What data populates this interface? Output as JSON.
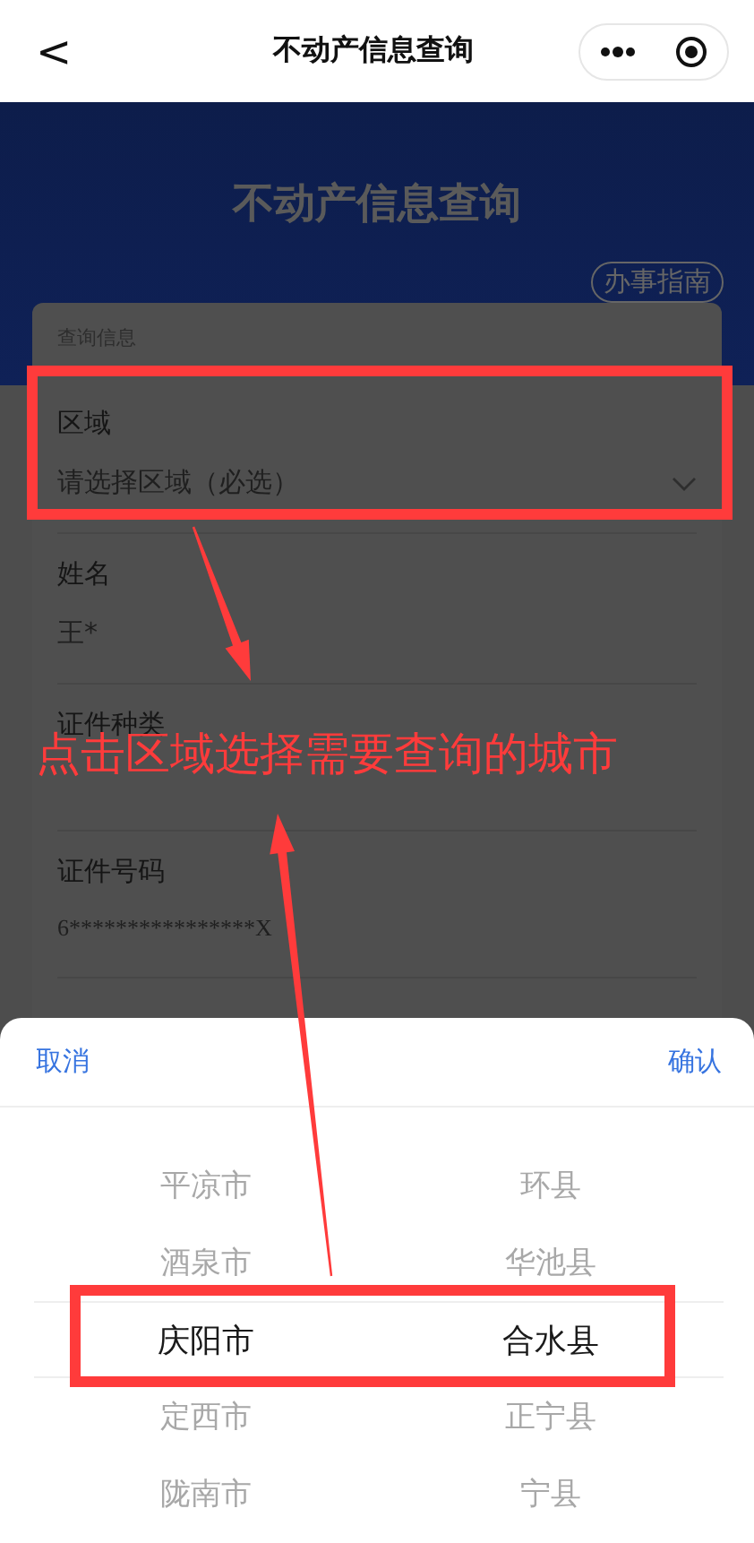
{
  "nav": {
    "back": "<",
    "title": "不动产信息查询"
  },
  "header": {
    "title": "不动产信息查询",
    "guide_button": "办事指南"
  },
  "form": {
    "section_title": "查询信息",
    "fields": [
      {
        "kind": "select",
        "label": "区域",
        "placeholder": "请选择区域（必选）"
      },
      {
        "kind": "text",
        "label": "姓名",
        "value": "王*"
      },
      {
        "kind": "text",
        "label": "证件种类"
      },
      {
        "kind": "text",
        "label": "证件号码",
        "value": "6****************X"
      }
    ]
  },
  "picker": {
    "cancel": "取消",
    "confirm": "确认",
    "columns": [
      {
        "items": [
          {
            "label": "平凉市",
            "selected": false
          },
          {
            "label": "酒泉市",
            "selected": false
          },
          {
            "label": "庆阳市",
            "selected": true
          },
          {
            "label": "定西市",
            "selected": false
          },
          {
            "label": "陇南市",
            "selected": false
          }
        ]
      },
      {
        "items": [
          {
            "label": "环县",
            "selected": false
          },
          {
            "label": "华池县",
            "selected": false
          },
          {
            "label": "合水县",
            "selected": true
          },
          {
            "label": "正宁县",
            "selected": false
          },
          {
            "label": "宁县",
            "selected": false
          }
        ]
      }
    ]
  },
  "annotation": {
    "note": "点击区域选择需要查询的城市"
  }
}
